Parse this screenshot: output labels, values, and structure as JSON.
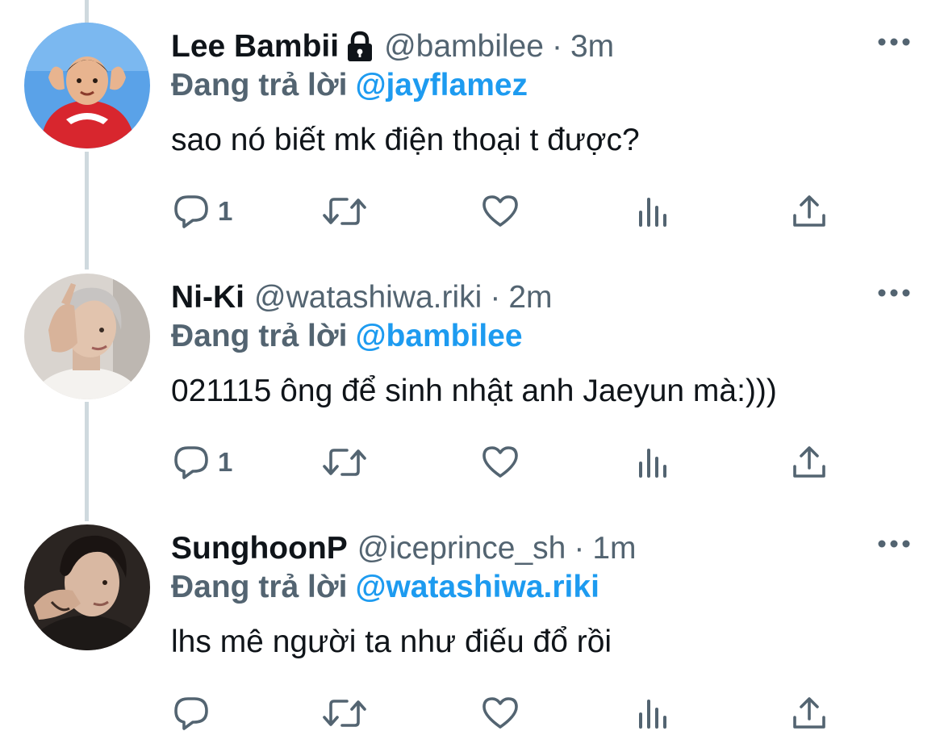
{
  "tweets": [
    {
      "display_name": "Lee Bambii",
      "protected": true,
      "handle": "@bambilee",
      "separator": "·",
      "time": "3m",
      "reply_prefix": "Đang trả lời",
      "reply_to": "@jayflamez",
      "text": "sao nó biết mk điện thoại t được?",
      "reply_count": "1",
      "avatar": "avatar-child-red-sweater"
    },
    {
      "display_name": "Ni-Ki",
      "protected": false,
      "handle": "@watashiwa.riki",
      "separator": "·",
      "time": "2m",
      "reply_prefix": "Đang trả lời",
      "reply_to": "@bambilee",
      "text": "021115 ông để sinh nhật anh Jaeyun mà:)))",
      "reply_count": "1",
      "avatar": "avatar-young-man-hand-gesture"
    },
    {
      "display_name": "SunghoonP",
      "protected": false,
      "handle": "@iceprince_sh",
      "separator": "·",
      "time": "1m",
      "reply_prefix": "Đang trả lời",
      "reply_to": "@watashiwa.riki",
      "text": "lhs mê người ta như điếu đổ rồi",
      "reply_count": "",
      "avatar": "avatar-young-man-dark"
    }
  ],
  "colors": {
    "text_primary": "#0f1419",
    "text_secondary": "#536471",
    "accent": "#1d9bf0",
    "thread_line": "#cfd9de"
  },
  "icons": {
    "more": "more-horizontal-icon",
    "lock": "lock-icon",
    "reply": "reply-bubble-icon",
    "retweet": "retweet-icon",
    "like": "heart-icon",
    "views": "bar-chart-icon",
    "share": "share-upload-icon"
  }
}
